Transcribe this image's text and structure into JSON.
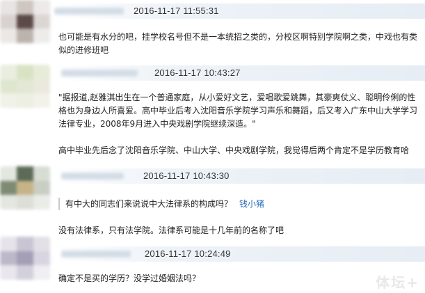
{
  "comments": [
    {
      "timestamp": "2016-11-17 11:55:31",
      "lines": [
        "也可能是有水分的吧，挂学校名号但不是一本统招之类的，分校区啊特别学院啊之类，中戏也有类",
        "似的进修班吧"
      ]
    },
    {
      "timestamp": "2016-11-17 10:43:27",
      "lines": [
        "\"据报道,赵雅淇出生在一个普通家庭，从小爱好文艺，爱唱歌爱跳舞，其豪爽仗义、聪明伶俐的性",
        "格也为身边人所喜爱。高中毕业后考入沈阳音乐学院学习声乐和舞蹈，后又考入广东中山大学学习",
        "法律专业，2008年9月进入中央戏剧学院继续深造。\""
      ],
      "extra_line": "高中毕业先后念了沈阳音乐学院、中山大学、中央戏剧学院，我觉得后两个肯定不是学历教育哈"
    },
    {
      "timestamp": "2016-11-17 10:43:30",
      "quote_text": "有中大的同志们来说说中大法律系的构成吗？",
      "quote_author": "钱小猪",
      "lines": [
        "没有法律系，只有法学院。法律系可能是十几年前的名称了吧"
      ]
    },
    {
      "timestamp": "2016-11-17 10:24:49",
      "lines": [
        "确定不是买的学历？没学过婚姻法吗？"
      ]
    }
  ],
  "watermark": "体坛+",
  "colors": {
    "link": "#2a6cb8",
    "meta_bar": "#e6edf4",
    "quote_border": "#c8c8c8"
  }
}
